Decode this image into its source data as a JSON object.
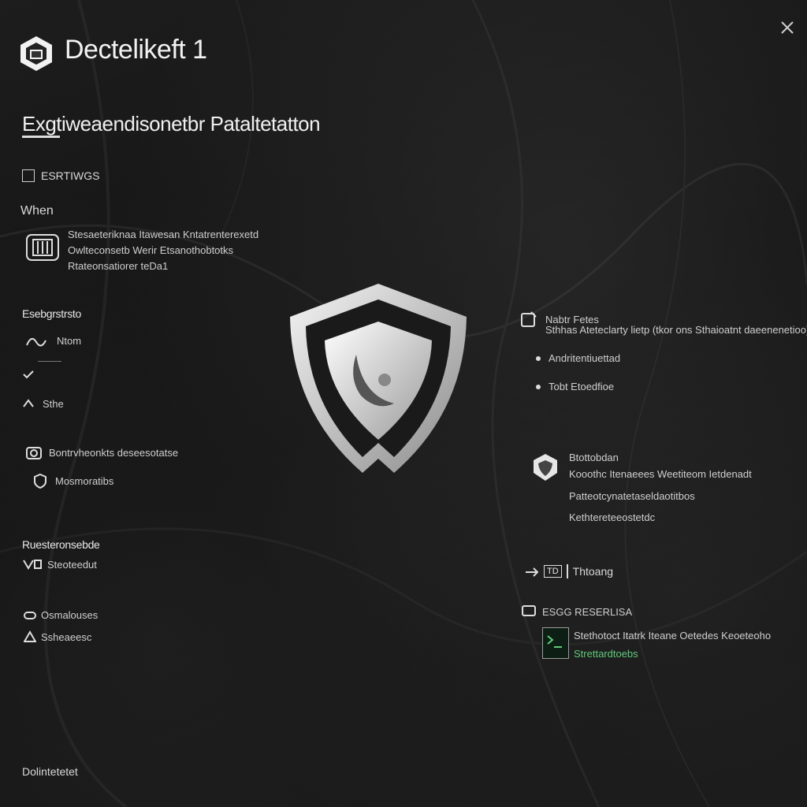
{
  "app": {
    "title": "Dectelikeft 1",
    "close_icon": "close-icon"
  },
  "page": {
    "subtitle": "Exgtiweaendisonetbr Pataltetatton"
  },
  "left": {
    "option": {
      "label": "ESRTIWGS"
    },
    "when": {
      "label": "When"
    },
    "description": {
      "line1": "Stesaeteriknaa Itawesan Kntatrenterexetd",
      "line2": "Owlteconsetb Werir Etsanothobtotks",
      "line3": "Rtateonsatiorer teDa1"
    },
    "section1": {
      "title": "Esebgrstrsto",
      "item1": "Ntom",
      "item3": "Sthe"
    },
    "section2": {
      "item1": "Bontrvheonkts deseesotatse",
      "item2": "Mosmoratibs"
    },
    "section3": {
      "title": "Ruesteronsebde",
      "item1": "Steoteedut"
    },
    "section4": {
      "title": "Osmalouses",
      "item1": "Ssheaeesc"
    },
    "footer": "Dolintetetet"
  },
  "right": {
    "block1": {
      "title": "Nabtr  Fetes",
      "line1": "Sthhas Ateteclarty lietp (tkor ons Sthaioatnt daeenenetioo)",
      "bullet1": "Andritentiuettad",
      "bullet2": "Tobt Etoedfioe"
    },
    "block2": {
      "title": "Btottobdan",
      "line1": "Kooothc Itenaeees Weetiteom Ietdenadt",
      "line2": "Patteotcynatetaseldaotitbos",
      "line3": "Kethtereteeostetdc"
    },
    "block3": {
      "badge": "TD",
      "label": "Thtoang"
    },
    "block4": {
      "title": "ESGG RESERLISA",
      "line1": "Stethotoct Itatrk Iteane Oetedes Keoeteoho",
      "line2": "Strettardtoebs"
    }
  },
  "colors": {
    "background": "#141414",
    "text": "#e6e6e6",
    "accent_green": "#5ecb7a"
  }
}
